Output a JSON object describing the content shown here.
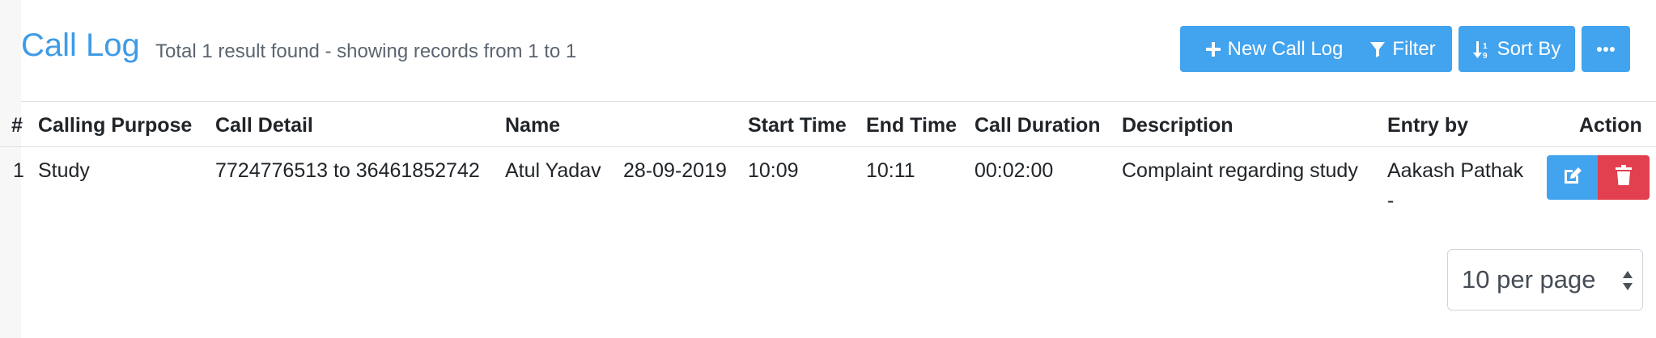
{
  "header": {
    "title": "Call Log",
    "subtitle": "Total 1 result found - showing records from 1 to 1"
  },
  "toolbar": {
    "new_label": "New Call Log",
    "filter_label": "Filter",
    "sort_label": "Sort By"
  },
  "table": {
    "columns": [
      "#",
      "Calling Purpose",
      "Call Detail",
      "Name",
      "Start Time",
      "End Time",
      "Call Duration",
      "Description",
      "Entry by",
      "Action"
    ],
    "rows": [
      {
        "index": "1",
        "purpose": "Study",
        "detail": "7724776513 to 36461852742",
        "name": "Atul Yadav",
        "date": "28-09-2019",
        "start": "10:09",
        "end": "10:11",
        "duration": "00:02:00",
        "description": "Complaint regarding study",
        "entry_by": "Aakash Pathak",
        "entry_by_extra": "-"
      }
    ]
  },
  "pagination": {
    "per_page": "10 per page"
  },
  "colors": {
    "primary": "#42a3ee",
    "danger": "#e2404f",
    "title": "#3e9be6"
  },
  "icons": {
    "new": "plus-icon",
    "filter": "filter-icon",
    "sort": "sort-icon",
    "more": "ellipsis-icon",
    "edit": "edit-icon",
    "delete": "trash-icon"
  }
}
